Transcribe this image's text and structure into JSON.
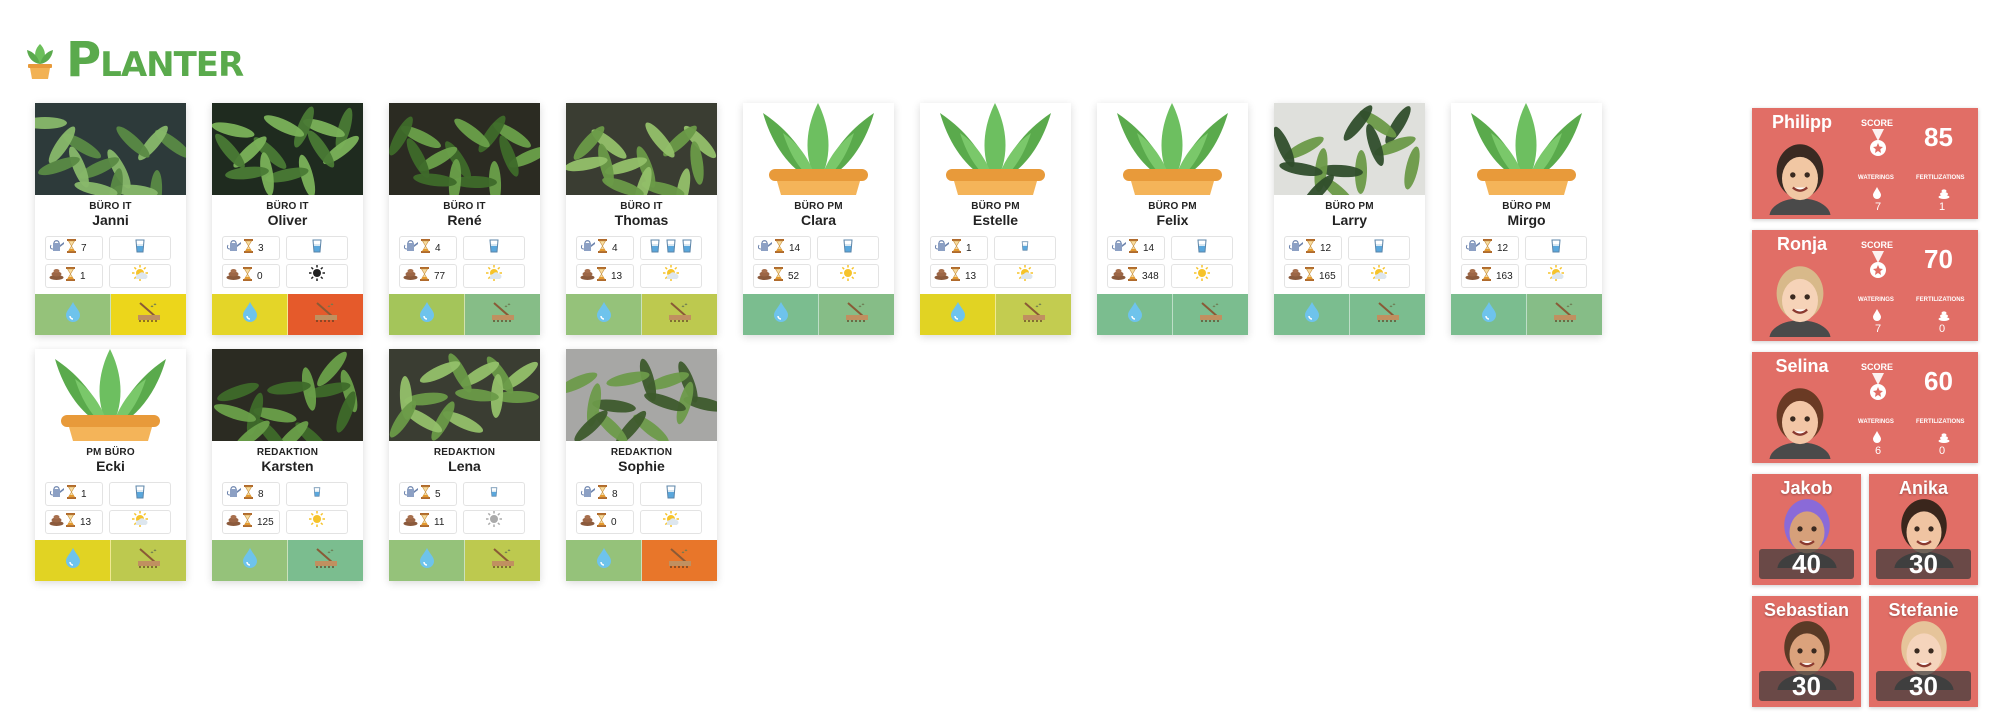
{
  "app": {
    "title": "Planter",
    "logo_icon": "potted-plant-icon"
  },
  "colors": {
    "brand": "#5aaa4c",
    "card_red": "#e16e66"
  },
  "plants": [
    {
      "dept": "BÜRO IT",
      "name": "Janni",
      "water_days": "7",
      "water_level": "1",
      "fert_days": "1",
      "sun": "partial",
      "photo": "photo",
      "act_water": "#95c27a",
      "act_fert": "#ecd61b",
      "fert_urgent": false
    },
    {
      "dept": "BÜRO IT",
      "name": "Oliver",
      "water_days": "3",
      "water_level": "1",
      "fert_days": "0",
      "sun": "dark",
      "photo": "photo",
      "act_water": "#e4d528",
      "act_fert": "#e55a2b",
      "fert_urgent": false
    },
    {
      "dept": "BÜRO IT",
      "name": "René",
      "water_days": "4",
      "water_level": "1",
      "fert_days": "77",
      "sun": "partial",
      "photo": "photo",
      "act_water": "#a4c55a",
      "act_fert": "#86bd87",
      "fert_urgent": false
    },
    {
      "dept": "BÜRO IT",
      "name": "Thomas",
      "water_days": "4",
      "water_level": "3",
      "fert_days": "13",
      "sun": "partial",
      "photo": "photo",
      "act_water": "#95c27a",
      "act_fert": "#bdc94f",
      "fert_urgent": false
    },
    {
      "dept": "BÜRO PM",
      "name": "Clara",
      "water_days": "14",
      "water_level": "1",
      "fert_days": "52",
      "sun": "full",
      "photo": "illustration",
      "act_water": "#7bbd8f",
      "act_fert": "#86bd87",
      "fert_urgent": false
    },
    {
      "dept": "BÜRO PM",
      "name": "Estelle",
      "water_days": "1",
      "water_level": "small",
      "fert_days": "13",
      "sun": "partial",
      "photo": "illustration",
      "act_water": "#e1d323",
      "act_fert": "#c3cc50",
      "fert_urgent": false
    },
    {
      "dept": "BÜRO PM",
      "name": "Felix",
      "water_days": "14",
      "water_level": "1",
      "fert_days": "348",
      "sun": "full",
      "photo": "illustration",
      "act_water": "#7bbd8f",
      "act_fert": "#7bbd8f",
      "fert_urgent": false
    },
    {
      "dept": "BÜRO PM",
      "name": "Larry",
      "water_days": "12",
      "water_level": "1",
      "fert_days": "165",
      "sun": "partial",
      "photo": "photo",
      "act_water": "#7bbd8f",
      "act_fert": "#7bbd8f",
      "fert_urgent": false
    },
    {
      "dept": "BÜRO PM",
      "name": "Mirgo",
      "water_days": "12",
      "water_level": "1",
      "fert_days": "163",
      "sun": "partial",
      "photo": "illustration",
      "act_water": "#7bbd8f",
      "act_fert": "#86bd87",
      "fert_urgent": false
    },
    {
      "dept": "PM BÜRO",
      "name": "Ecki",
      "water_days": "1",
      "water_level": "1",
      "fert_days": "13",
      "sun": "partial",
      "photo": "illustration",
      "act_water": "#e1d323",
      "act_fert": "#bdc94f",
      "fert_urgent": false
    },
    {
      "dept": "REDAKTION",
      "name": "Karsten",
      "water_days": "8",
      "water_level": "small",
      "fert_days": "125",
      "sun": "full",
      "photo": "photo",
      "act_water": "#95c27a",
      "act_fert": "#7bbd8f",
      "fert_urgent": false
    },
    {
      "dept": "REDAKTION",
      "name": "Lena",
      "water_days": "5",
      "water_level": "small",
      "fert_days": "11",
      "sun": "grey",
      "photo": "photo",
      "act_water": "#95c27a",
      "act_fert": "#bdc94f",
      "fert_urgent": false
    },
    {
      "dept": "REDAKTION",
      "name": "Sophie",
      "water_days": "8",
      "water_level": "1",
      "fert_days": "0",
      "sun": "partial",
      "photo": "photo",
      "act_water": "#95c27a",
      "act_fert": "#e8762a",
      "fert_urgent": false
    }
  ],
  "leaderboard": {
    "score_label": "SCORE",
    "waterings_label": "WATERINGS",
    "fertilizations_label": "FERTILIZATIONS",
    "top": [
      {
        "name": "Philipp",
        "score": "85",
        "waterings": "7",
        "fertilizations": "1"
      },
      {
        "name": "Ronja",
        "score": "70",
        "waterings": "7",
        "fertilizations": "0"
      },
      {
        "name": "Selina",
        "score": "60",
        "waterings": "6",
        "fertilizations": "0"
      }
    ],
    "rest": [
      {
        "name": "Jakob",
        "score": "40"
      },
      {
        "name": "Anika",
        "score": "30"
      },
      {
        "name": "Sebastian",
        "score": "30"
      },
      {
        "name": "Stefanie",
        "score": "30"
      }
    ]
  }
}
